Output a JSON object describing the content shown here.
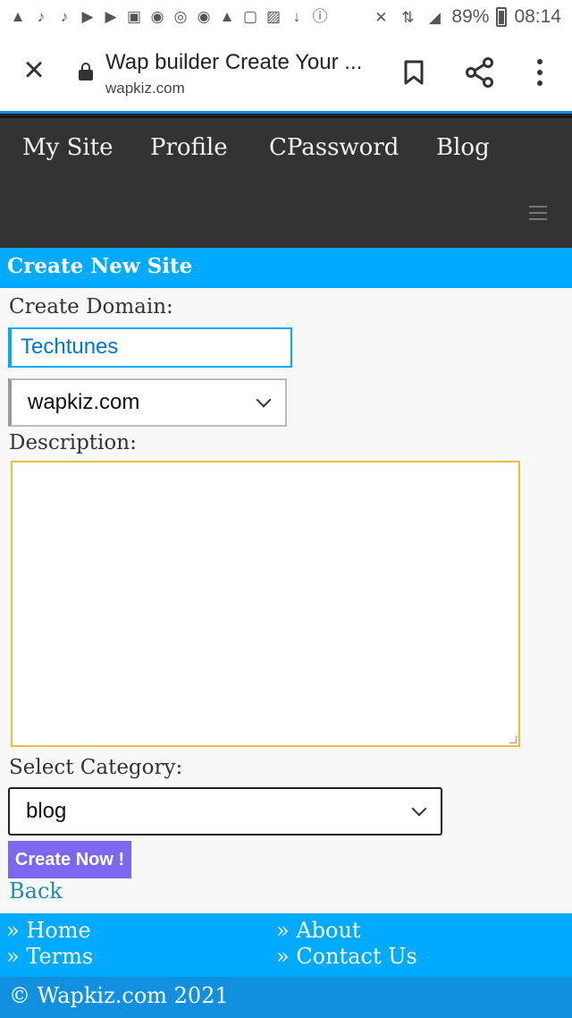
{
  "status_bar": {
    "battery": "89%",
    "time": "08:14",
    "notification_icons": [
      "alert-icon",
      "tiktok-icon",
      "tiktok-icon",
      "youtube-icon",
      "youtube-icon",
      "bag-icon",
      "messenger-icon",
      "sync-icon",
      "messenger-icon",
      "alert-icon",
      "file-icon",
      "image-icon",
      "download-icon",
      "info-icon"
    ],
    "right_icons": [
      "mute-icon",
      "data-icon",
      "signal-icon",
      "battery-icon"
    ]
  },
  "browser": {
    "page_title": "Wap builder Create Your ...",
    "url": "wapkiz.com",
    "close_glyph": "×"
  },
  "nav": {
    "items": [
      {
        "label": "My Site"
      },
      {
        "label": "Profile"
      },
      {
        "label": "CPassword"
      },
      {
        "label": "Blog"
      }
    ]
  },
  "form": {
    "heading": "Create New Site",
    "domain_label": "Create Domain:",
    "domain_value": "Techtunes",
    "domain_suffix": "wapkiz.com",
    "description_label": "Description:",
    "description_value": "",
    "category_label": "Select Category:",
    "category_value": "blog",
    "submit_label": "Create Now !",
    "back_label": "Back"
  },
  "footer": {
    "links": [
      {
        "label": "» Home"
      },
      {
        "label": "» About"
      },
      {
        "label": "» Terms"
      },
      {
        "label": "» Contact Us"
      }
    ],
    "copyright": "© Wapkiz.com 2021"
  },
  "colors": {
    "accent": "#00aaff",
    "nav_bg": "#333333",
    "button": "#7b68ee",
    "link": "#1e8aa8"
  }
}
